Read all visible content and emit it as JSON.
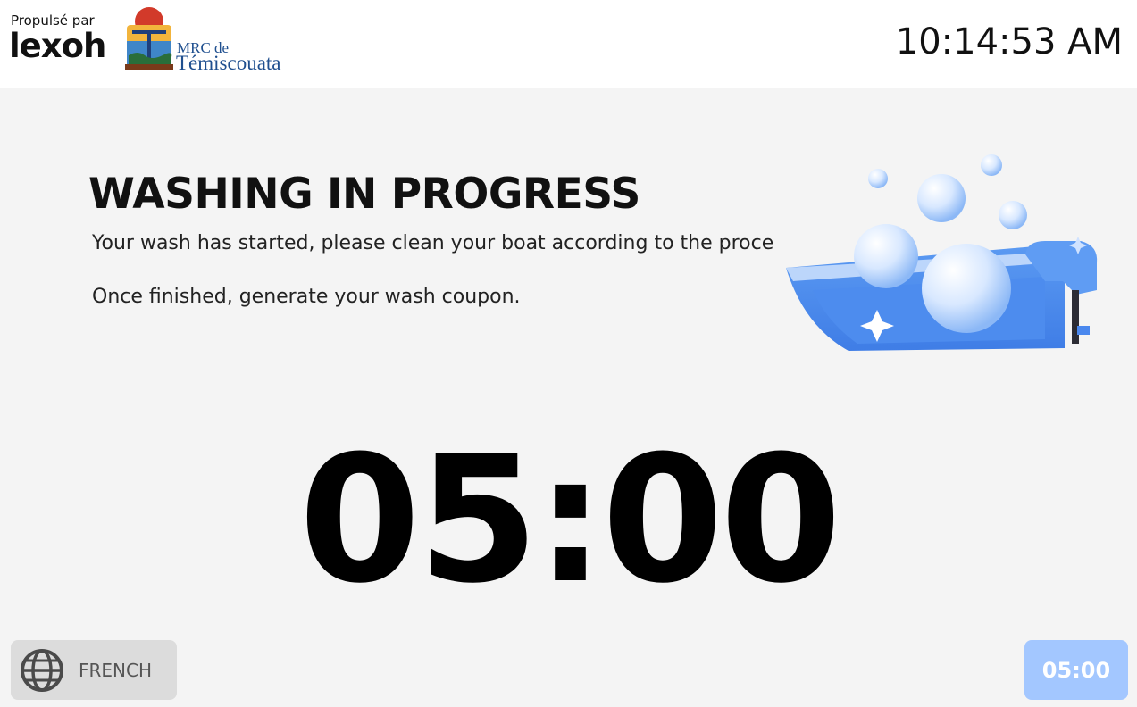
{
  "header": {
    "powered_by": "Propulsé par",
    "brand": "lexoh",
    "partner_line1": "MRC de",
    "partner_line2": "Témiscouata",
    "clock": "10:14:53 AM"
  },
  "main": {
    "title": "WASHING IN PROGRESS",
    "message_line1": "Your wash has started, please clean your boat according to the proce",
    "message_line2": "Once finished, generate your wash coupon.",
    "illustration_icon": "boat-wash-bubbles-icon",
    "timer": "05:00"
  },
  "footer": {
    "language_label": "FRENCH",
    "language_icon": "globe-icon",
    "timer_button_label": "05:00"
  },
  "colors": {
    "background": "#f4f4f4",
    "header": "#ffffff",
    "timer_button": "#a3c7ff",
    "language_button": "#dcdcdc",
    "boat_blue": "#4f8ff0"
  }
}
